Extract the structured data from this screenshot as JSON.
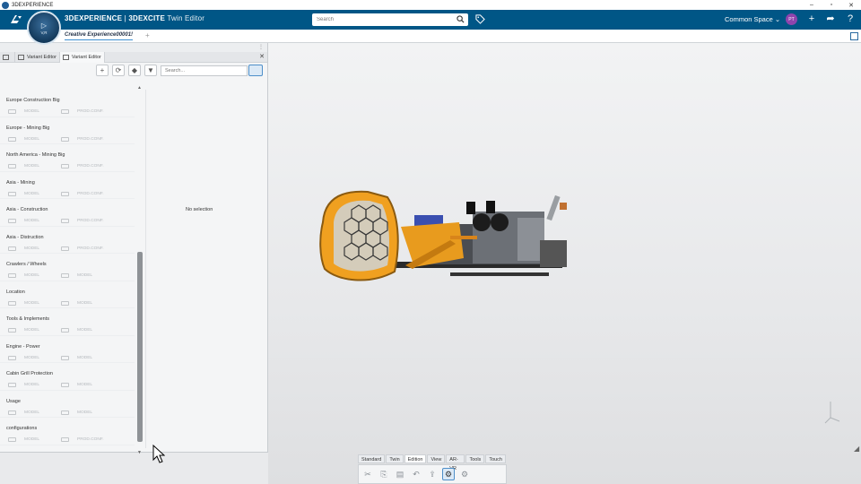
{
  "os": {
    "title": "3DEXPERIENCE",
    "min": "–",
    "max": "▫",
    "close": "✕"
  },
  "header": {
    "brand_bold": "3DEXPERIENCE",
    "brand_sep": " | ",
    "brand_app": "3DEXCITE",
    "brand_mode": " Twin Editor",
    "compass_label": "V,R",
    "search_placeholder": "Search",
    "space": "Common Space",
    "avatar": "PT",
    "plus": "+",
    "share": "➦",
    "help": "?"
  },
  "tabbar": {
    "tab": "Creative Experience00001!",
    "add": "+"
  },
  "panel": {
    "tabs": [
      "Variant Editor",
      "Variant Editor"
    ],
    "close": "✕",
    "search_placeholder": "Search...",
    "empty_state": "No selection",
    "items": [
      {
        "label": "Europe Construction Big",
        "chips": [
          "MODEL",
          "PROD.CONF."
        ]
      },
      {
        "label": "Europe - Mining Big",
        "chips": [
          "MODEL",
          "PROD.CONF."
        ]
      },
      {
        "label": "North America - Mining Big",
        "chips": [
          "MODEL",
          "PROD.CONF."
        ]
      },
      {
        "label": "Asia - Mining",
        "chips": [
          "MODEL",
          "PROD.CONF."
        ]
      },
      {
        "label": "Asia - Construction",
        "chips": [
          "MODEL",
          "PROD.CONF."
        ]
      },
      {
        "label": "Asia - Distruction",
        "chips": [
          "MODEL",
          "PROD.CONF."
        ]
      },
      {
        "label": "Crawlers / Wheels",
        "chips": [
          "MODEL",
          "MODEL"
        ]
      },
      {
        "label": "Location",
        "chips": [
          "MODEL",
          "MODEL"
        ]
      },
      {
        "label": "Tools & Implements",
        "chips": [
          "MODEL",
          "MODEL"
        ]
      },
      {
        "label": "Engine - Power",
        "chips": [
          "MODEL",
          "MODEL"
        ]
      },
      {
        "label": "Cabin Grill Protection",
        "chips": [
          "MODEL",
          "MODEL"
        ]
      },
      {
        "label": "Usage",
        "chips": [
          "MODEL",
          "MODEL"
        ]
      },
      {
        "label": "configurations",
        "chips": [
          "MODEL",
          "PROD.CONF."
        ]
      }
    ]
  },
  "actionbar": {
    "tabs": [
      "Standard",
      "Twin",
      "Edition",
      "View",
      "AR-VR",
      "Tools",
      "Touch"
    ],
    "active_tab": "Edition"
  },
  "colors": {
    "header_bg": "#005686",
    "accent": "#3b8ed1",
    "avatar": "#8e44ad",
    "model_orange": "#f0a020"
  }
}
